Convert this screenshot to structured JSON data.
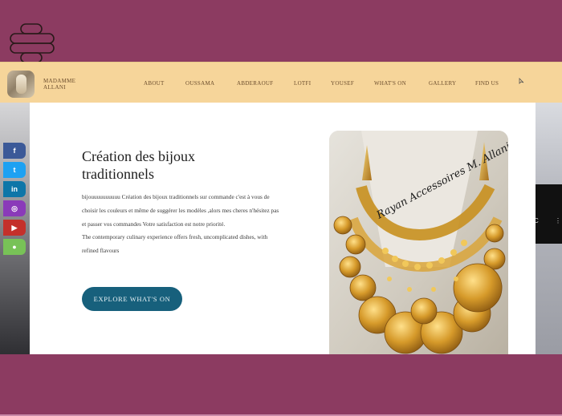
{
  "header": {
    "brand_name": "MADAMME ALLANI",
    "nav": [
      {
        "label": "ABOUT"
      },
      {
        "label": "OUSSAMA"
      },
      {
        "label": "ABDERAOUF"
      },
      {
        "label": "LOTFI"
      },
      {
        "label": "YOUSEF"
      },
      {
        "label": "WHAT'S ON"
      },
      {
        "label": "GALLERY"
      },
      {
        "label": "FIND US"
      }
    ]
  },
  "hero": {
    "title": "Création des bijoux traditionnels",
    "paragraph1": "bijouuuuuuuuuu Création des bijoux traditionnels sur commande c'est à vous de choisir les couleurs et même de suggérer les modèles ,alors mes cheres n'hésitez pas et passer vos commandes Votre satisfaction est notre priorité.",
    "paragraph2": "The contemporary culinary experience offers fresh, uncomplicated dishes, with refined flavours",
    "cta_label": "EXPLORE WHAT'S ON",
    "image_signature": "Rayan Accessoires M. Allani"
  },
  "social": [
    {
      "icon": "facebook-icon",
      "glyph": "f",
      "color": "#3b5998"
    },
    {
      "icon": "twitter-icon",
      "glyph": "t",
      "color": "#1da1f2"
    },
    {
      "icon": "linkedin-icon",
      "glyph": "in",
      "color": "#0e76a8"
    },
    {
      "icon": "instagram-icon",
      "glyph": "◎",
      "color": "#8a3ab9"
    },
    {
      "icon": "youtube-icon",
      "glyph": "▶",
      "color": "#c4302b"
    },
    {
      "icon": "android-icon",
      "glyph": "●",
      "color": "#78c257"
    }
  ],
  "colors": {
    "page_bg": "#8c3b61",
    "header_bg": "#f6d59a",
    "cta_bg": "#17607c"
  }
}
